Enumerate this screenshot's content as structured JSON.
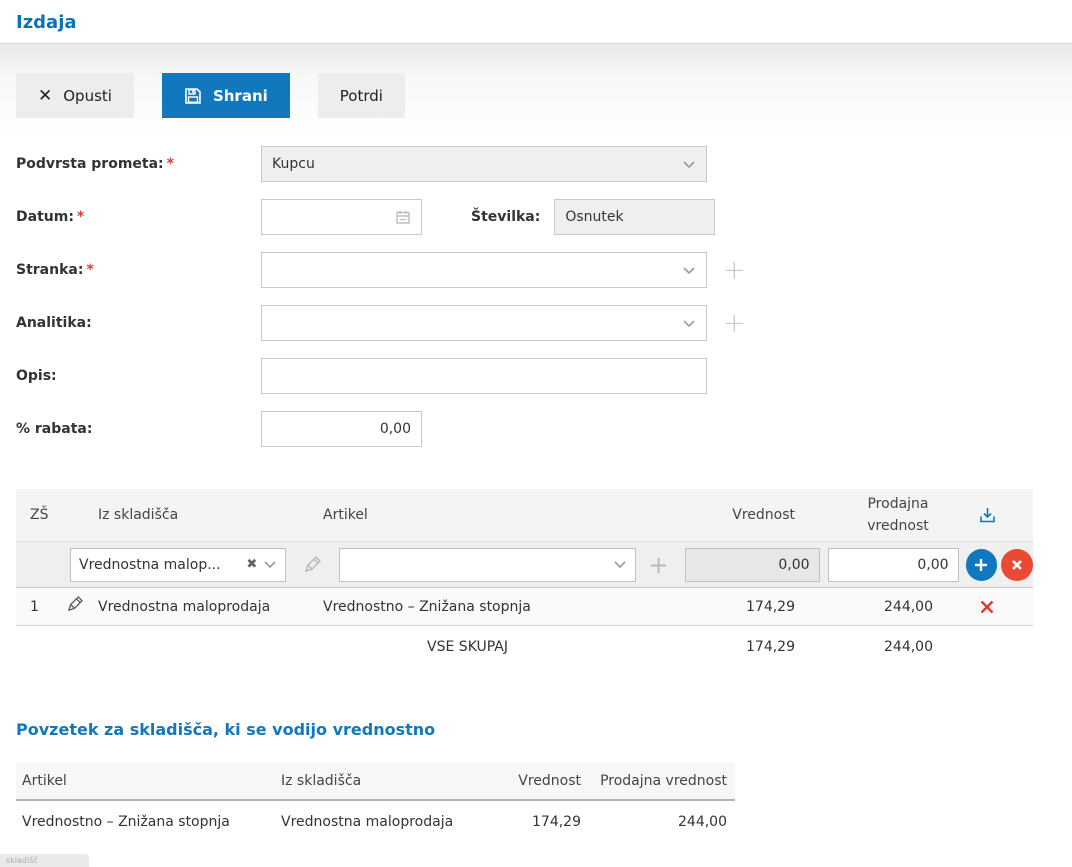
{
  "page": {
    "title": "Izdaja"
  },
  "toolbar": {
    "discard_label": "Opusti",
    "save_label": "Shrani",
    "confirm_label": "Potrdi"
  },
  "form": {
    "required_marker": "*",
    "podvrsta": {
      "label": "Podvrsta prometa:",
      "value": "Kupcu"
    },
    "datum": {
      "label": "Datum:",
      "value": ""
    },
    "stevilka": {
      "label": "Številka:",
      "value": "Osnutek"
    },
    "stranka": {
      "label": "Stranka:",
      "value": ""
    },
    "analitika": {
      "label": "Analitika:",
      "value": ""
    },
    "opis": {
      "label": "Opis:",
      "value": ""
    },
    "rabata": {
      "label": "% rabata:",
      "value": "0,00"
    }
  },
  "items_table": {
    "headers": {
      "zs": "ZŠ",
      "warehouse": "Iz skladišča",
      "article": "Artikel",
      "value": "Vrednost",
      "sales_value": "Prodajna vrednost"
    },
    "edit_row": {
      "warehouse_value": "Vrednostna malop...",
      "article_value": "",
      "value": "0,00",
      "sales_value": "0,00"
    },
    "rows": [
      {
        "zs": "1",
        "warehouse": "Vrednostna maloprodaja",
        "article": "Vrednostno – Znižana stopnja",
        "value": "174,29",
        "sales_value": "244,00"
      }
    ],
    "total": {
      "label": "VSE SKUPAJ",
      "value": "174,29",
      "sales_value": "244,00"
    }
  },
  "summary": {
    "title": "Povzetek za skladišča, ki se vodijo vrednostno",
    "headers": {
      "article": "Artikel",
      "warehouse": "Iz skladišča",
      "value": "Vrednost",
      "sales_value": "Prodajna vrednost"
    },
    "rows": [
      {
        "article": "Vrednostno – Znižana stopnja",
        "warehouse": "Vrednostna maloprodaja",
        "value": "174,29",
        "sales_value": "244,00"
      }
    ]
  },
  "tooltip": {
    "text": "skladišč"
  },
  "icons": {
    "discard": "x-cross",
    "save": "floppy-disk",
    "calendar": "calendar",
    "chevron": "chevron-down",
    "add": "plus",
    "edit": "pencil",
    "import_rows": "download-tray",
    "delete": "red-x",
    "clear": "small-x"
  },
  "colors": {
    "accent_blue": "#1178be",
    "title_blue": "#0b72b5",
    "danger_red": "#ea4a33",
    "required_red": "#d43f3a"
  }
}
